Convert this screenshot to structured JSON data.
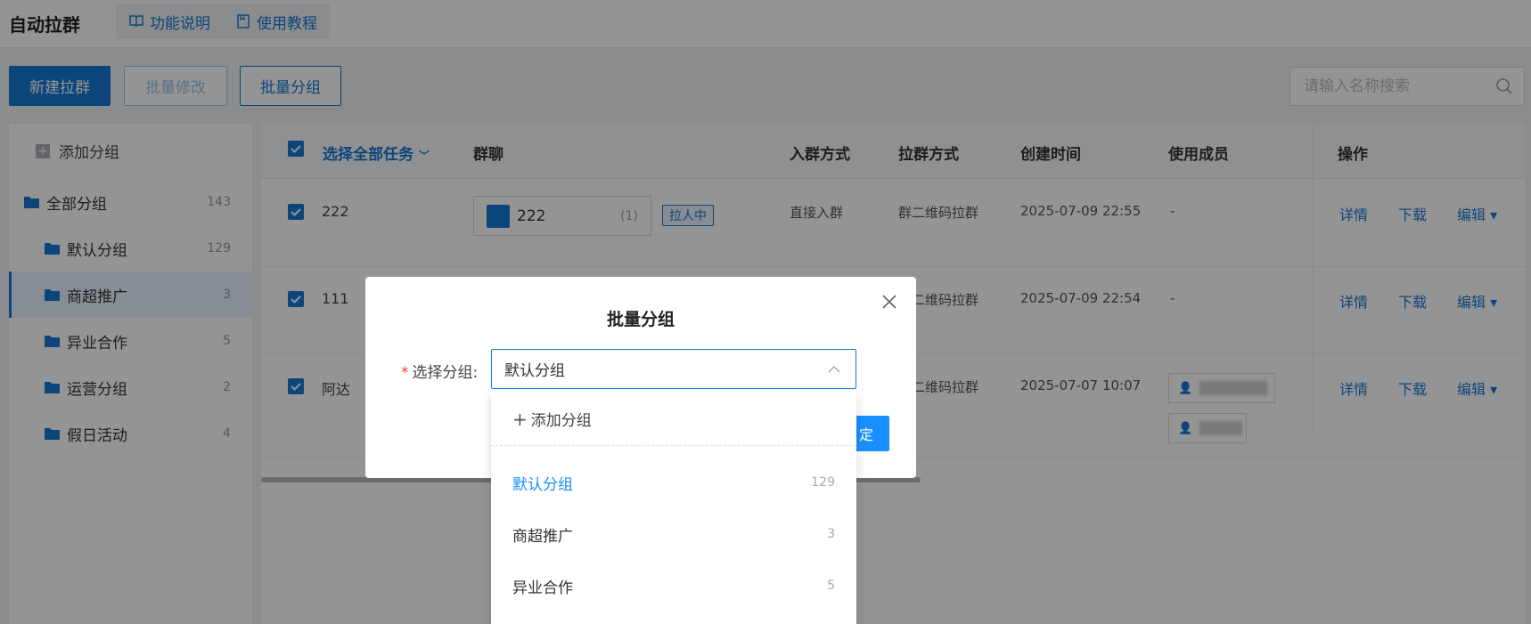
{
  "app": {
    "title": "自动拉群"
  },
  "top_links": [
    {
      "label": "功能说明",
      "icon": "book-icon"
    },
    {
      "label": "使用教程",
      "icon": "document-icon"
    }
  ],
  "toolbar": {
    "new_label": "新建拉群",
    "batch_edit_label": "批量修改",
    "batch_group_label": "批量分组"
  },
  "search": {
    "placeholder": "请输入名称搜索"
  },
  "sidebar": {
    "add_label": "添加分组",
    "items": [
      {
        "label": "全部分组",
        "count": "143"
      },
      {
        "label": "默认分组",
        "count": "129"
      },
      {
        "label": "商超推广",
        "count": "3"
      },
      {
        "label": "异业合作",
        "count": "5"
      },
      {
        "label": "运营分组",
        "count": "2"
      },
      {
        "label": "假日活动",
        "count": "4"
      }
    ]
  },
  "table": {
    "headers": {
      "select_all": "选择全部任务",
      "group_chat": "群聊",
      "join_method": "入群方式",
      "pull_method": "拉群方式",
      "created_at": "创建时间",
      "members": "使用成员",
      "operations": "操作"
    },
    "rows": [
      {
        "name": "222",
        "chat": "222",
        "chat_count": "(1)",
        "status": "拉人中",
        "join": "直接入群",
        "pull": "群二维码拉群",
        "created": "2025-07-09 22:55",
        "member": "-"
      },
      {
        "name": "111",
        "pull": "群二维码拉群",
        "created": "2025-07-09 22:54",
        "member": "-"
      },
      {
        "name": "阿达",
        "pull": "群二维码拉群",
        "created": "2025-07-07 10:07"
      }
    ],
    "actions": {
      "detail": "详情",
      "download": "下载",
      "edit": "编辑"
    }
  },
  "modal": {
    "title": "批量分组",
    "field_label": "选择分组:",
    "selected": "默认分组",
    "confirm_label": "定",
    "dropdown": {
      "add_label": "添加分组",
      "options": [
        {
          "label": "默认分组",
          "count": "129"
        },
        {
          "label": "商超推广",
          "count": "3"
        },
        {
          "label": "异业合作",
          "count": "5"
        }
      ]
    }
  },
  "colors": {
    "primary": "#1677d2",
    "selected": "#1890ff",
    "required": "#f04134"
  }
}
